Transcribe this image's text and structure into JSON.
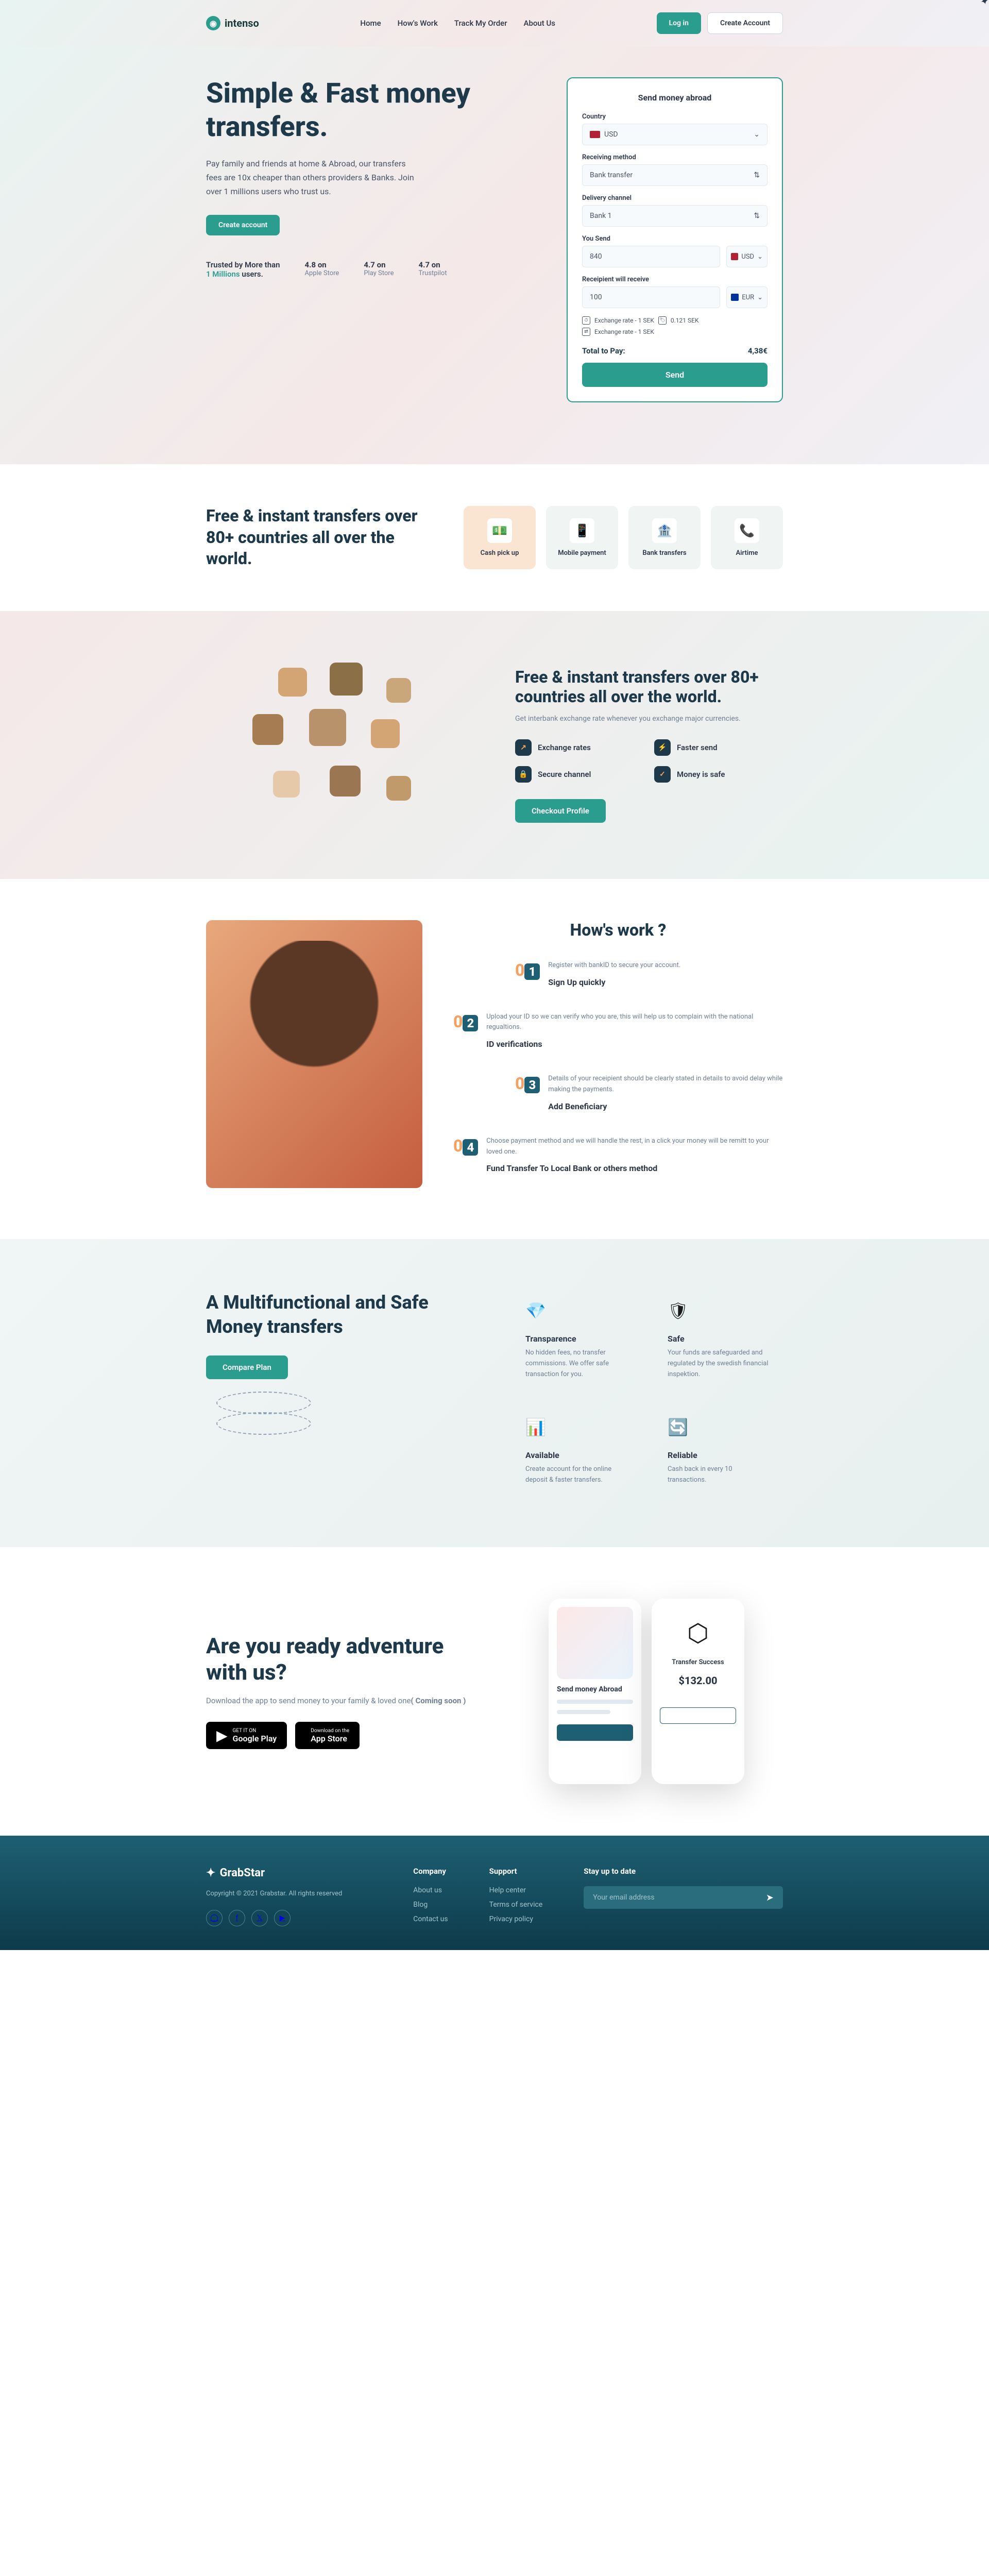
{
  "brand": "intenso",
  "nav": {
    "home": "Home",
    "how": "How's Work",
    "track": "Track My Order",
    "about": "About Us"
  },
  "header": {
    "login": "Log in",
    "create": "Create Account"
  },
  "hero": {
    "title": "Simple & Fast money transfers.",
    "sub": "Pay family and friends at home & Abroad, our transfers fees are 10x cheaper than others providers & Banks.\nJoin over 1 millions users who trust us.",
    "cta": "Create account",
    "trust_text": "Trusted by More than",
    "trust_count": "1 Millions",
    "trust_suffix": "users.",
    "ratings": [
      {
        "val": "4.8 on",
        "sub": "Apple Store"
      },
      {
        "val": "4.7 on",
        "sub": "Play Store"
      },
      {
        "val": "4.7 on",
        "sub": "Trustpilot"
      }
    ]
  },
  "form": {
    "title": "Send money abroad",
    "country_label": "Country",
    "country": "USD",
    "method_label": "Receiving method",
    "method": "Bank transfer",
    "channel_label": "Delivery channel",
    "channel": "Bank 1",
    "send_label": "You Send",
    "send_val": "840",
    "send_cur": "USD",
    "recv_label": "Receipient will receive",
    "recv_val": "100",
    "recv_cur": "EUR",
    "rate1_label": "Exchange rate - 1 SEK",
    "rate1_val": "0.121 SEK",
    "rate2_label": "Exchange rate - 1 SEK",
    "total_label": "Total to Pay:",
    "total_val": "4,38€",
    "send_btn": "Send"
  },
  "features": {
    "title": "Free & instant transfers over 80+ countries all over the world.",
    "cards": [
      {
        "label": "Cash pick up",
        "emoji": "💵"
      },
      {
        "label": "Mobile payment",
        "emoji": "📱"
      },
      {
        "label": "Bank transfers",
        "emoji": "🏦"
      },
      {
        "label": "Airtime",
        "emoji": "📞"
      }
    ]
  },
  "world": {
    "title": "Free & instant transfers over 80+ countries all over the world.",
    "sub": "Get interbank exchange rate whenever you exchange major currencies.",
    "benefits": [
      {
        "icon": "↗",
        "label": "Exchange rates"
      },
      {
        "icon": "⚡",
        "label": "Faster send"
      },
      {
        "icon": "🔒",
        "label": "Secure channel"
      },
      {
        "icon": "✓",
        "label": "Money is safe"
      }
    ],
    "cta": "Checkout Profile"
  },
  "how": {
    "title": "How's work ?",
    "steps": [
      {
        "num": "1",
        "title": "Sign Up quickly",
        "desc": "Register with bankID to secure your account."
      },
      {
        "num": "2",
        "title": "ID verifications",
        "desc": "Upload your ID so we can verify who you are, this will help us to complain with the national regualtions."
      },
      {
        "num": "3",
        "title": "Add Beneficiary",
        "desc": "Details of your receipient should be clearly stated in details to avoid delay while making the payments."
      },
      {
        "num": "4",
        "title": "Fund Transfer To Local Bank or others method",
        "desc": "Choose payment method and we will handle the rest, in a click your money will be remitt to your loved one."
      }
    ]
  },
  "multi": {
    "title": "A Multifunctional and Safe Money transfers",
    "cta": "Compare Plan",
    "items": [
      {
        "icon_color": "#2a9d8f",
        "icon": "💎",
        "title": "Transparence",
        "desc": "No hidden fees, no transfer commissions. We offer safe transaction for you."
      },
      {
        "icon_color": "#f4a261",
        "icon": "🛡",
        "title": "Safe",
        "desc": "Your funds are safeguarded and regulated by the swedish financial inspektion."
      },
      {
        "icon_color": "#f4a261",
        "icon": "📊",
        "title": "Available",
        "desc": "Create account for the online deposit & faster transfers."
      },
      {
        "icon_color": "#2a9d8f",
        "icon": "🔄",
        "title": "Reliable",
        "desc": "Cash back in every 10 transactions."
      }
    ]
  },
  "cta": {
    "title": "Are you ready adventure with us?",
    "sub": "Download the app to send money to your family & loved one",
    "soon": "( Coming soon )",
    "gp_small": "GET IT ON",
    "gp_big": "Google Play",
    "as_small": "Download on the",
    "as_big": "App Store",
    "phone1_title": "Send money Abroad",
    "phone2_title": "Transfer Success",
    "phone2_amount": "$132.00"
  },
  "footer": {
    "brand": "GrabStar",
    "copy": "Copyright © 2021 Grabstar.\nAll rights reserved",
    "company": {
      "title": "Company",
      "links": [
        "About us",
        "Blog",
        "Contact us"
      ]
    },
    "support": {
      "title": "Support",
      "links": [
        "Help center",
        "Terms of service",
        "Privacy policy"
      ]
    },
    "sub": {
      "title": "Stay up to date",
      "placeholder": "Your email address"
    }
  }
}
